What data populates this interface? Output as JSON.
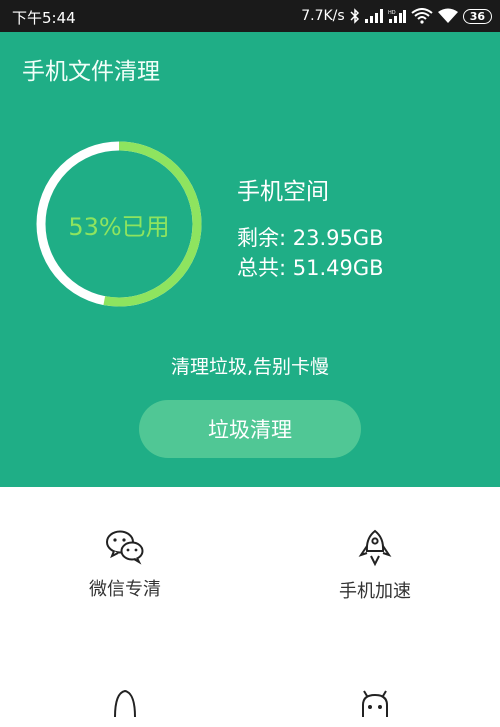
{
  "status_bar": {
    "time": "下午5:44",
    "speed": "7.7K/s",
    "battery": "36",
    "icons": [
      "bluetooth-icon",
      "signal-icon",
      "hd-signal-icon",
      "wifi-icon",
      "battery-icon"
    ]
  },
  "header": {
    "title": "手机文件清理"
  },
  "storage": {
    "used_label": "53%已用",
    "used_fraction": 0.53,
    "title": "手机空间",
    "remaining_label": "剩余: 23.95GB",
    "total_label": "总共: 51.49GB"
  },
  "slogan": "清理垃圾,告别卡慢",
  "clean_button": "垃圾清理",
  "features": [
    {
      "label": "微信专清",
      "icon": "wechat-icon"
    },
    {
      "label": "手机加速",
      "icon": "rocket-icon"
    },
    {
      "label": "",
      "icon": "qq-penguin-icon"
    },
    {
      "label": "",
      "icon": "android-robot-icon"
    }
  ],
  "colors": {
    "primary": "#1fae86",
    "button": "#50c795",
    "ring_used": "#8ee45f",
    "ring_track": "#ffffff"
  }
}
